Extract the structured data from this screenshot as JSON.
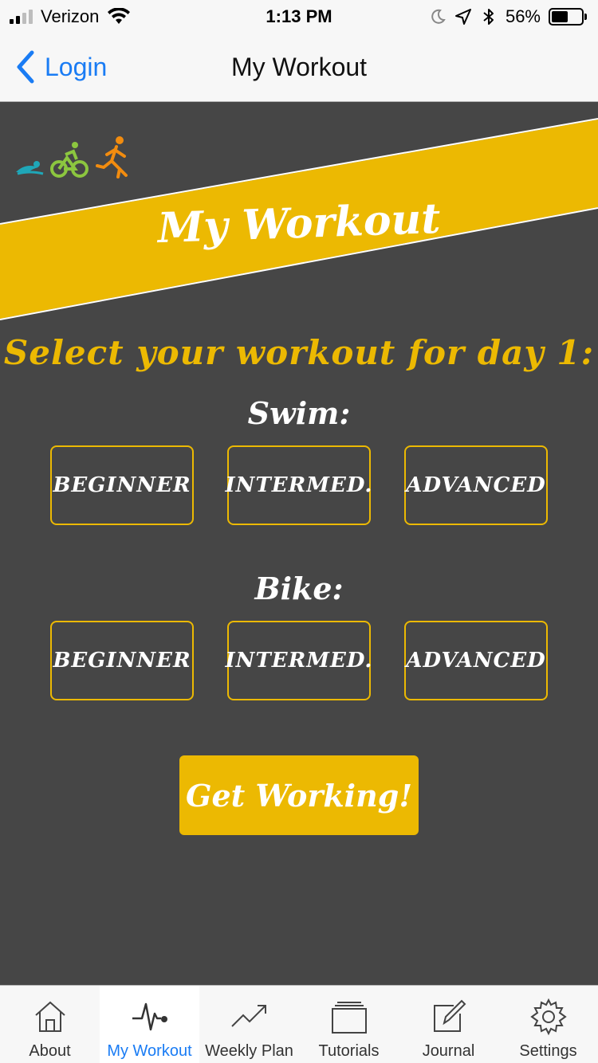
{
  "status_bar": {
    "carrier": "Verizon",
    "time": "1:13 PM",
    "battery_percent": "56%",
    "battery_level": 0.56
  },
  "nav": {
    "back_label": "Login",
    "title": "My Workout"
  },
  "hero": {
    "title": "My Workout",
    "icons": [
      "swim-icon",
      "bike-icon",
      "run-icon"
    ],
    "band_color": "#ecb902"
  },
  "main": {
    "headline": "Select your workout for day 1:",
    "swim": {
      "label": "Swim:",
      "options": [
        "BEGINNER",
        "INTERMED.",
        "ADVANCED"
      ]
    },
    "bike": {
      "label": "Bike:",
      "options": [
        "BEGINNER",
        "INTERMED.",
        "ADVANCED"
      ]
    },
    "cta_label": "Get Working!"
  },
  "tabs": [
    {
      "label": "About",
      "icon": "house-icon"
    },
    {
      "label": "My Workout",
      "icon": "pulse-icon",
      "active": true
    },
    {
      "label": "Weekly Plan",
      "icon": "trend-icon"
    },
    {
      "label": "Tutorials",
      "icon": "stack-icon"
    },
    {
      "label": "Journal",
      "icon": "edit-icon"
    },
    {
      "label": "Settings",
      "icon": "gear-icon"
    }
  ],
  "colors": {
    "accent": "#ecb902",
    "background": "#464646",
    "ios_blue": "#1a7cf4"
  }
}
